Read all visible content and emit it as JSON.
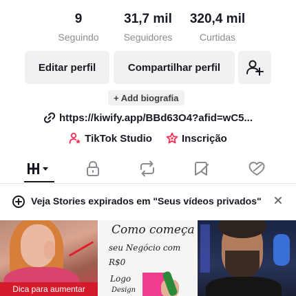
{
  "stats": [
    {
      "value": "9",
      "label": "Seguindo"
    },
    {
      "value": "31,7 mil",
      "label": "Seguidores"
    },
    {
      "value": "320,4 mil",
      "label": "Curtidas"
    }
  ],
  "actions": {
    "edit_label": "Editar perfil",
    "share_label": "Compartilhar perfil",
    "add_friend_icon": "person-plus-icon"
  },
  "bio": {
    "add_label": "+ Add biografia"
  },
  "link": {
    "text": "https://kiwify.app/BBd63O4?afid=wC5..."
  },
  "shortcuts": {
    "studio_label": "TikTok Studio",
    "subscription_label": "Inscrição",
    "accent": "#fe2c55"
  },
  "tabs": [
    {
      "icon": "videos-grid-icon",
      "active": true
    },
    {
      "icon": "lock-icon",
      "active": false
    },
    {
      "icon": "repost-icon",
      "active": false
    },
    {
      "icon": "bookmark-icon",
      "active": false
    },
    {
      "icon": "liked-heart-icon",
      "active": false
    }
  ],
  "notice": {
    "text": "Veja Stories expirados em \"Seus vídeos privados\""
  },
  "videos": [
    {
      "caption": "Dica para aumentar"
    },
    {
      "lines": [
        "Como começa",
        "seu Negócio com",
        "R$0",
        "Logo",
        "Design"
      ]
    },
    {}
  ]
}
